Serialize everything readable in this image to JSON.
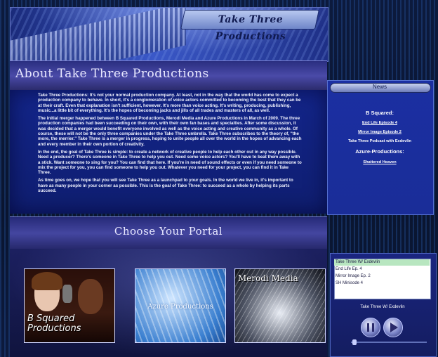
{
  "header": {
    "logo_text": "Take Three Productions"
  },
  "about": {
    "title": "About Take Three Productions",
    "paragraphs": [
      "Take Three Productions: It's not your normal production company. At least, not in the way that the world has come to expect a production company to behave. In short, it's a conglomeration of voice actors committed to becoming the best that they can be at their craft. Even that explanation isn't sufficient, however. It's more than voice acting. It's writing, producing, publishing, music...a little bit of everything. It's the hopes of becoming jacks and jills of all trades and masters of all, as well.",
      "The initial merger happened between B Squared Productions, Merodi Media and Azure Productions in March of 2009. The three production companies had been succeeding on their own, with their own fan bases and specialties. After some discussion, it was decided that a merger would benefit everyone involved as well as the voice acting and creative community as a whole. Of course, these will not be the only three companies under the Take Three umbrella. Take Three subscribes to the theory of, \"the more, the merrier.\" Take Three is a merger in progress, hoping to unite people all over the world in the hopes of advancing each and every member in their own portion of creativity.",
      "In the end, the goal of Take Three is simple: to create a network of creative people to help each other out in any way possible. Need a producer? There's someone in Take Three to help you out. Need some voice actors? You'll have to beat them away with a stick. Want someone to sing for you? You can find that here. If you're in need of sound effects or even if you need someone to mix the project for you, you can find someone to help you out. Whatever you need for your project, you can find it in Take Three.",
      "As time goes on, we hope that you will see Take Three as a launchpad to your goals. In the world we live in, it's important to have as many people in your corner as possible. This is the goal of Take Three: to succeed as a whole by helping its parts succeed."
    ]
  },
  "news": {
    "label": "News",
    "section1": "B Squared:",
    "link1": "End Life Episode 4",
    "link2": "Mirror Image Episode 2",
    "item3": "Take Three Podcast with Exdevlin",
    "section2": "Azure-Productions:",
    "link3": "Shattered Heaven"
  },
  "portal": {
    "title": "Choose Your Portal",
    "bsquared_label": "B Squared\nProductions",
    "azure_label": "Azure Productions",
    "merodi_label": "Merodi Media"
  },
  "player": {
    "playlist": [
      "Take Three W/ Exdevlin",
      "End Life Ep. 4",
      "Mirror Image Ep. 2",
      "SH Minisode 4"
    ],
    "now_playing": "Take Three W/ Exdevlin"
  }
}
